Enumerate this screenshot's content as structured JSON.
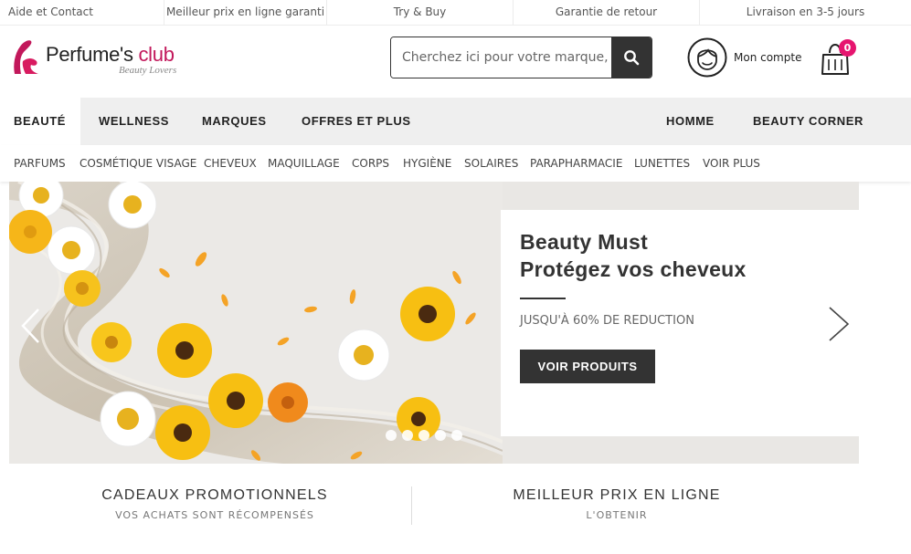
{
  "topbar": {
    "items": [
      "Aide et Contact",
      "Meilleur prix en ligne garanti",
      "Try & Buy",
      "Garantie de retour",
      "Livraison en 3-5 jours"
    ]
  },
  "header": {
    "logo": {
      "name_part1": "Perfume's ",
      "name_part2": "club",
      "tagline": "Beauty Lovers"
    },
    "search": {
      "placeholder": "Cherchez ici pour votre marque, produit...",
      "icon": "search-icon"
    },
    "account": {
      "label": "Mon compte",
      "icon": "user-face-icon"
    },
    "cart": {
      "count": "0",
      "icon": "shopping-bag-icon"
    }
  },
  "main_nav": {
    "items": [
      "BEAUTÉ",
      "WELLNESS",
      "MARQUES",
      "OFFRES ET PLUS",
      "HOMME",
      "BEAUTY CORNER"
    ],
    "active": "BEAUTÉ"
  },
  "sub_nav": {
    "items": [
      "PARFUMS",
      "COSMÉTIQUE VISAGE",
      "CHEVEUX",
      "MAQUILLAGE",
      "CORPS",
      "HYGIÈNE",
      "SOLAIRES",
      "PARAPHARMACIE",
      "LUNETTES",
      "VOIR PLUS"
    ]
  },
  "hero": {
    "title_line1": "Beauty Must",
    "title_line2": "Protégez vos cheveux",
    "subtitle": "JUSQU'À 60% DE REDUCTION",
    "cta": "VOIR PRODUITS",
    "slide_count": 5,
    "colors": {
      "cta_bg": "#333333",
      "background": "#e9e7e4"
    }
  },
  "benefits": [
    {
      "title": "CADEAUX PROMOTIONNELS",
      "subtitle": "VOS ACHATS SONT RÉCOMPENSÉS"
    },
    {
      "title": "MEILLEUR PRIX EN LIGNE",
      "subtitle": "L'OBTENIR"
    }
  ],
  "colors": {
    "brand": "#c2185b",
    "badge": "#e6156f",
    "dark": "#333333",
    "nav_bg": "#efefef"
  }
}
